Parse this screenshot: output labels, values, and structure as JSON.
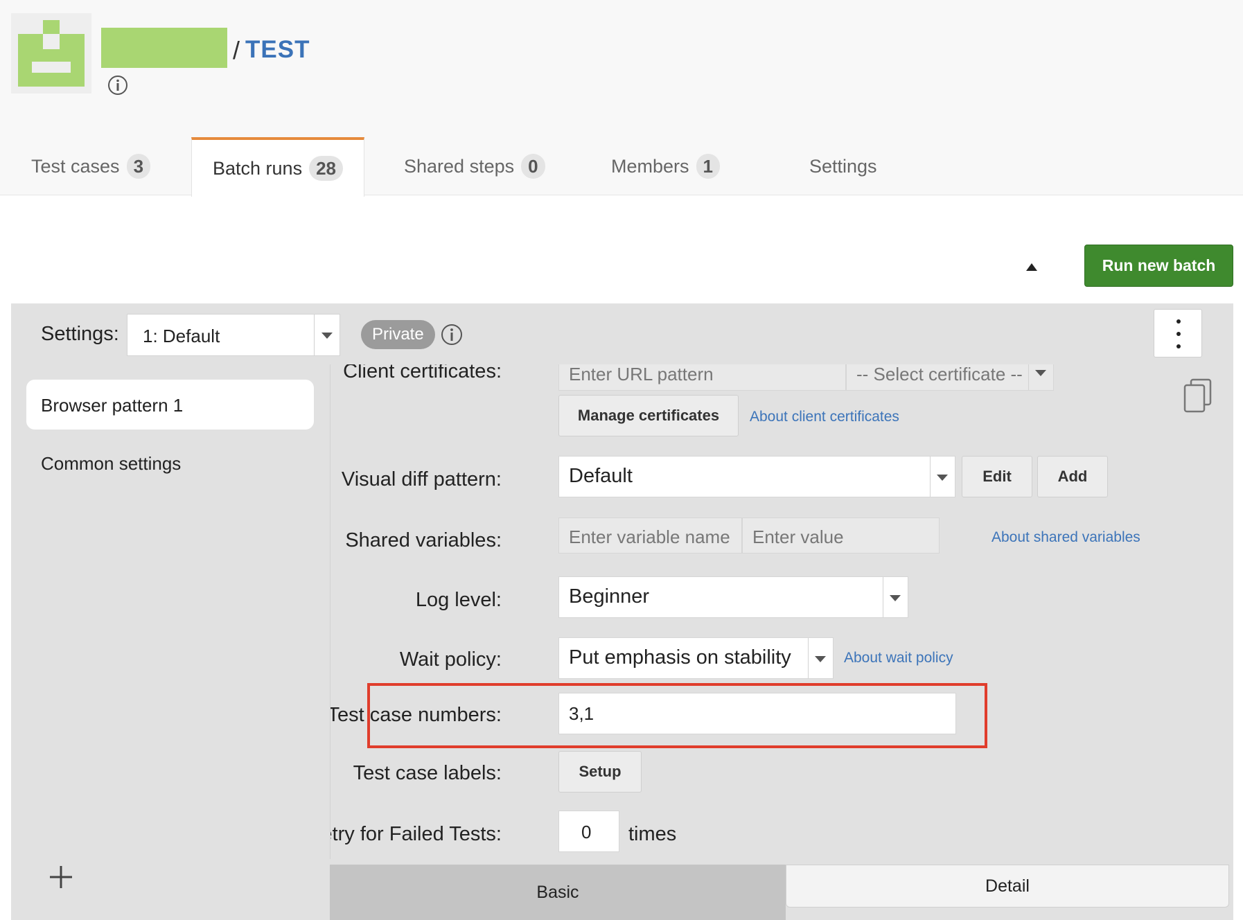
{
  "header": {
    "title": "TEST",
    "separator": "/",
    "brand_color": "#a9d672"
  },
  "tabs": [
    {
      "label": "Test cases",
      "count": "3"
    },
    {
      "label": "Batch runs",
      "count": "28",
      "active": true
    },
    {
      "label": "Shared steps",
      "count": "0"
    },
    {
      "label": "Members",
      "count": "1"
    },
    {
      "label": "Settings"
    }
  ],
  "toolbar": {
    "run_label": "Run new batch",
    "run_color": "#3f8a2e"
  },
  "settings": {
    "label": "Settings:",
    "selected": "1: Default",
    "visibility": "Private"
  },
  "sidebar": {
    "items": [
      {
        "label": "Browser pattern 1",
        "active": true
      },
      {
        "label": "Common settings"
      }
    ]
  },
  "form": {
    "client_cert": {
      "label": "Client certificates:",
      "url_placeholder": "Enter URL pattern",
      "cert_placeholder": "-- Select certificate --",
      "manage_label": "Manage certificates",
      "about_label": "About client certificates"
    },
    "visual_diff": {
      "label": "Visual diff pattern:",
      "value": "Default",
      "edit_label": "Edit",
      "add_label": "Add"
    },
    "shared_vars": {
      "label": "Shared variables:",
      "name_placeholder": "Enter variable name",
      "value_placeholder": "Enter value",
      "about_label": "About shared variables"
    },
    "log_level": {
      "label": "Log level:",
      "value": "Beginner"
    },
    "wait_policy": {
      "label": "Wait policy:",
      "value": "Put emphasis on stability",
      "about_label": "About wait policy"
    },
    "test_case_numbers": {
      "label": "Test case numbers:",
      "value": "3,1",
      "highlight_color": "#e03d2c"
    },
    "test_case_labels": {
      "label": "Test case labels:",
      "setup_label": "Setup"
    },
    "retry": {
      "label": "Retry for Failed Tests:",
      "value": "0",
      "unit": "times"
    }
  },
  "bottom_tabs": [
    {
      "label": "Basic",
      "active": true
    },
    {
      "label": "Detail"
    }
  ]
}
